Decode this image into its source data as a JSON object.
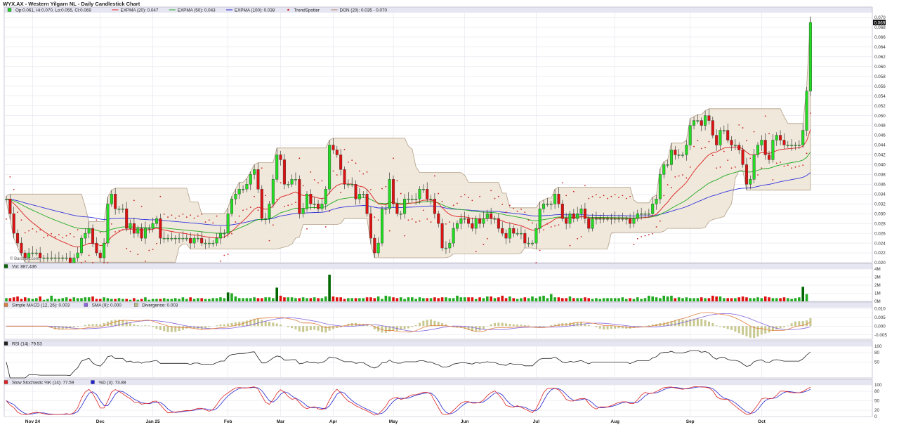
{
  "header": {
    "title": "WYX.AX - Western Yilgarn NL - Daily Candlestick Chart"
  },
  "main_panel": {
    "legend": [
      {
        "label": "Op:0.061, Hi:0.070, Lo:0.055, Cl:0.069",
        "color": "#22cc22",
        "marker": "box"
      },
      {
        "label": "EXPMA (20): 0.047",
        "color": "#dd2222",
        "marker": "line"
      },
      {
        "label": "EXPMA (50): 0.043",
        "color": "#22aa22",
        "marker": "line"
      },
      {
        "label": "EXPMA (100): 0.038",
        "color": "#2222cc",
        "marker": "line"
      },
      {
        "label": "TrendSpotter",
        "color": "#cc2222",
        "marker": "dot"
      },
      {
        "label": "DON (20): 0.035 - 0.070",
        "color": "#b08060",
        "marker": "line"
      }
    ],
    "watermark": "© Barchart.com",
    "last_price_tag": "0.069"
  },
  "volume_panel": {
    "legend": "Vol: 887,436",
    "legend_color": "#006600"
  },
  "macd_panel": {
    "legend": [
      {
        "label": "Simple MACD (12, 26): 0.003",
        "color": "#e08040"
      },
      {
        "label": "SMA (9): 0.000",
        "color": "#8866dd"
      },
      {
        "label": "Divergence: 0.003",
        "color": "#bbbb88"
      }
    ]
  },
  "rsi_panel": {
    "legend": "RSI (14): 79.53",
    "legend_color": "#222222"
  },
  "stoch_panel": {
    "legend": [
      {
        "label": "Slow Stochastic %K (14): 77.59",
        "color": "#dd2222"
      },
      {
        "label": "%D (3): 73.88",
        "color": "#2222cc"
      }
    ]
  },
  "x_axis_labels": [
    {
      "label": "Nov 24",
      "i": 7
    },
    {
      "label": "Dec",
      "i": 25
    },
    {
      "label": "Jan 25",
      "i": 39
    },
    {
      "label": "Feb",
      "i": 59
    },
    {
      "label": "Mar",
      "i": 73
    },
    {
      "label": "Apr",
      "i": 87
    },
    {
      "label": "May",
      "i": 103
    },
    {
      "label": "Jun",
      "i": 122
    },
    {
      "label": "Jul",
      "i": 141
    },
    {
      "label": "Aug",
      "i": 162
    },
    {
      "label": "Sep",
      "i": 182
    },
    {
      "label": "Oct",
      "i": 201
    }
  ],
  "chart_data": {
    "type": "candlestick",
    "title": "WYX.AX - Western Yilgarn NL - Daily Candlestick Chart",
    "price_ylim": [
      0.02,
      0.071
    ],
    "price_ticks": [
      "0.020",
      "0.022",
      "0.024",
      "0.026",
      "0.028",
      "0.030",
      "0.032",
      "0.034",
      "0.036",
      "0.038",
      "0.040",
      "0.042",
      "0.044",
      "0.046",
      "0.048",
      "0.050",
      "0.052",
      "0.054",
      "0.056",
      "0.058",
      "0.060",
      "0.062",
      "0.064",
      "0.066",
      "0.068",
      "0.070"
    ],
    "close": [
      0.033,
      0.03,
      0.026,
      0.024,
      0.022,
      0.021,
      0.022,
      0.022,
      0.022,
      0.021,
      0.021,
      0.021,
      0.021,
      0.021,
      0.021,
      0.021,
      0.021,
      0.02,
      0.021,
      0.022,
      0.025,
      0.026,
      0.027,
      0.024,
      0.022,
      0.021,
      0.024,
      0.032,
      0.034,
      0.031,
      0.031,
      0.031,
      0.027,
      0.028,
      0.026,
      0.027,
      0.025,
      0.027,
      0.027,
      0.028,
      0.029,
      0.025,
      0.025,
      0.025,
      0.025,
      0.025,
      0.025,
      0.025,
      0.025,
      0.024,
      0.025,
      0.025,
      0.024,
      0.024,
      0.024,
      0.024,
      0.025,
      0.026,
      0.026,
      0.03,
      0.033,
      0.034,
      0.035,
      0.035,
      0.036,
      0.038,
      0.039,
      0.035,
      0.029,
      0.029,
      0.032,
      0.037,
      0.042,
      0.041,
      0.036,
      0.036,
      0.037,
      0.037,
      0.03,
      0.031,
      0.034,
      0.032,
      0.032,
      0.031,
      0.032,
      0.035,
      0.044,
      0.043,
      0.042,
      0.039,
      0.036,
      0.036,
      0.036,
      0.033,
      0.034,
      0.034,
      0.03,
      0.025,
      0.022,
      0.024,
      0.031,
      0.031,
      0.037,
      0.032,
      0.03,
      0.03,
      0.033,
      0.033,
      0.033,
      0.033,
      0.035,
      0.035,
      0.033,
      0.033,
      0.03,
      0.028,
      0.023,
      0.023,
      0.024,
      0.027,
      0.028,
      0.029,
      0.029,
      0.028,
      0.027,
      0.029,
      0.028,
      0.029,
      0.03,
      0.029,
      0.029,
      0.027,
      0.026,
      0.025,
      0.027,
      0.026,
      0.026,
      0.026,
      0.024,
      0.024,
      0.024,
      0.027,
      0.031,
      0.032,
      0.032,
      0.032,
      0.034,
      0.032,
      0.029,
      0.028,
      0.03,
      0.029,
      0.03,
      0.031,
      0.029,
      0.027,
      0.029,
      0.029,
      0.029,
      0.029,
      0.029,
      0.029,
      0.029,
      0.029,
      0.029,
      0.029,
      0.028,
      0.029,
      0.03,
      0.03,
      0.03,
      0.03,
      0.032,
      0.033,
      0.038,
      0.04,
      0.04,
      0.043,
      0.042,
      0.042,
      0.042,
      0.044,
      0.048,
      0.049,
      0.049,
      0.048,
      0.05,
      0.049,
      0.046,
      0.044,
      0.047,
      0.047,
      0.045,
      0.044,
      0.044,
      0.043,
      0.04,
      0.036,
      0.037,
      0.042,
      0.044,
      0.045,
      0.042,
      0.041,
      0.045,
      0.046,
      0.045,
      0.044,
      0.044,
      0.044,
      0.044,
      0.044,
      0.047,
      0.055,
      0.069
    ],
    "volume_M": [
      0.4,
      0.4,
      0.5,
      0.6,
      0.3,
      0.5,
      0.4,
      0.3,
      0.4,
      0.6,
      0.2,
      0.3,
      0.7,
      0.3,
      0.3,
      0.4,
      0.5,
      0.3,
      0.5,
      0.4,
      0.4,
      0.5,
      0.5,
      0.6,
      0.3,
      0.3,
      0.5,
      0.4,
      0.3,
      0.3,
      0.4,
      0.3,
      0.3,
      0.2,
      0.4,
      0.2,
      0.3,
      0.5,
      0.2,
      0.3,
      0.3,
      0.3,
      0.4,
      0.3,
      0.3,
      0.4,
      0.3,
      0.5,
      0.3,
      0.5,
      0.3,
      0.4,
      0.4,
      0.3,
      0.3,
      0.4,
      0.4,
      0.5,
      0.4,
      1.1,
      1.0,
      0.6,
      0.4,
      0.4,
      0.4,
      0.4,
      0.5,
      0.4,
      0.4,
      0.5,
      0.5,
      0.4,
      1.7,
      0.7,
      0.5,
      0.5,
      0.5,
      0.4,
      0.4,
      0.5,
      0.4,
      0.4,
      0.5,
      0.4,
      0.4,
      0.6,
      3.3,
      0.6,
      0.5,
      0.5,
      0.3,
      0.4,
      0.4,
      0.4,
      0.4,
      0.4,
      0.5,
      0.5,
      0.4,
      0.6,
      0.3,
      0.7,
      0.6,
      0.5,
      0.4,
      0.5,
      0.3,
      0.5,
      0.5,
      0.3,
      0.5,
      0.4,
      0.4,
      0.4,
      0.5,
      0.4,
      0.5,
      0.5,
      0.4,
      0.4,
      0.7,
      0.5,
      0.5,
      0.5,
      0.5,
      0.3,
      0.5,
      0.4,
      0.6,
      0.6,
      0.4,
      0.5,
      0.7,
      0.4,
      0.6,
      0.4,
      0.3,
      0.4,
      0.5,
      0.4,
      0.6,
      0.4,
      0.6,
      0.7,
      0.4,
      0.9,
      0.5,
      0.5,
      0.4,
      0.4,
      0.6,
      0.4,
      0.4,
      0.4,
      0.5,
      0.4,
      0.3,
      0.4,
      0.3,
      0.4,
      0.4,
      0.4,
      0.4,
      0.4,
      0.5,
      0.3,
      0.4,
      0.3,
      0.5,
      0.3,
      0.4,
      0.7,
      0.6,
      0.5,
      0.4,
      0.7,
      0.6,
      0.7,
      0.4,
      0.5,
      0.4,
      0.5,
      0.4,
      0.4,
      0.4,
      0.5,
      0.4,
      0.4,
      0.7,
      0.6,
      0.6,
      0.4,
      0.4,
      0.4,
      0.4,
      0.5,
      0.6,
      0.5,
      0.4,
      0.4,
      0.5,
      0.4,
      0.6,
      0.5,
      0.4,
      0.4,
      0.4,
      0.5,
      0.4,
      0.3,
      0.4,
      0.5,
      1.8,
      0.9
    ],
    "volume_ylim": [
      0,
      4
    ],
    "volume_ticks": [
      "0M",
      "1M",
      "2M",
      "3M",
      "4M"
    ],
    "macd_ylim": [
      -0.0075,
      0.0105
    ],
    "macd_ticks": [
      "-0.005",
      "0.000",
      "0.005",
      "0.010"
    ],
    "rsi_ylim": [
      0,
      100
    ],
    "rsi_ticks": [
      "50",
      "80",
      "100"
    ],
    "stoch_ylim": [
      0,
      100
    ],
    "stoch_ticks": [
      "0",
      "20",
      "50",
      "80",
      "100"
    ]
  }
}
